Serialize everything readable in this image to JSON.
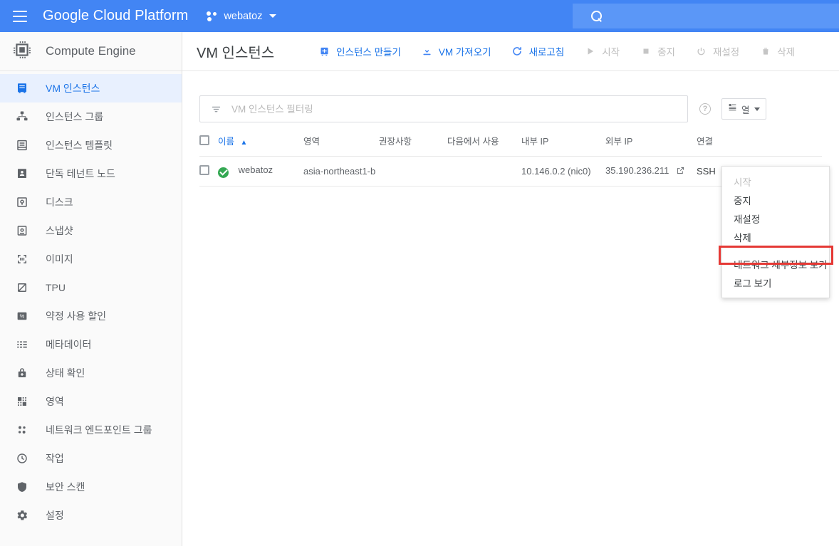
{
  "header": {
    "menu_icon": "hamburger-icon",
    "brand": "Google Cloud Platform",
    "project": "webatoz",
    "project_icon": "project-dots-icon",
    "search_icon": "search-icon",
    "search_value": "",
    "search_placeholder": "",
    "bg_color": "#4285f4"
  },
  "sidebar": {
    "product_icon": "cpu-chip-icon",
    "product": "Compute Engine",
    "items": [
      {
        "label": "VM 인스턴스",
        "icon": "vm-instance-icon",
        "active": true
      },
      {
        "label": "인스턴스 그룹",
        "icon": "instance-group-icon",
        "active": false
      },
      {
        "label": "인스턴스 템플릿",
        "icon": "instance-template-icon",
        "active": false
      },
      {
        "label": "단독 테넌트 노드",
        "icon": "sole-tenant-node-icon",
        "active": false
      },
      {
        "label": "디스크",
        "icon": "disk-icon",
        "active": false
      },
      {
        "label": "스냅샷",
        "icon": "snapshot-icon",
        "active": false
      },
      {
        "label": "이미지",
        "icon": "image-icon",
        "active": false
      },
      {
        "label": "TPU",
        "icon": "tpu-icon",
        "active": false
      },
      {
        "label": "약정 사용 할인",
        "icon": "percent-icon",
        "active": false
      },
      {
        "label": "메타데이터",
        "icon": "metadata-icon",
        "active": false
      },
      {
        "label": "상태 확인",
        "icon": "health-check-icon",
        "active": false
      },
      {
        "label": "영역",
        "icon": "zones-icon",
        "active": false
      },
      {
        "label": "네트워크 엔드포인트 그룹",
        "icon": "network-endpoint-group-icon",
        "active": false
      },
      {
        "label": "작업",
        "icon": "operations-clock-icon",
        "active": false
      },
      {
        "label": "보안 스캔",
        "icon": "security-scan-shield-icon",
        "active": false
      },
      {
        "label": "설정",
        "icon": "settings-gear-icon",
        "active": false
      }
    ]
  },
  "main": {
    "page_title": "VM 인스턴스",
    "toolbar": [
      {
        "label": "인스턴스 만들기",
        "icon": "create-instance-icon",
        "disabled": false
      },
      {
        "label": "VM 가져오기",
        "icon": "import-vm-download-icon",
        "disabled": false
      },
      {
        "label": "새로고침",
        "icon": "refresh-icon",
        "disabled": false
      },
      {
        "label": "시작",
        "icon": "play-start-icon",
        "disabled": true
      },
      {
        "label": "중지",
        "icon": "stop-square-icon",
        "disabled": true
      },
      {
        "label": "재설정",
        "icon": "reset-power-icon",
        "disabled": true
      },
      {
        "label": "삭제",
        "icon": "delete-trash-icon",
        "disabled": true
      }
    ],
    "filter": {
      "icon": "filter-icon",
      "placeholder": "VM 인스턴스 필터링",
      "value": "",
      "help_icon": "help-question-icon",
      "help_label": "?",
      "columns_label": "열",
      "columns_icon": "column-list-icon"
    },
    "table": {
      "columns": [
        "이름",
        "영역",
        "권장사항",
        "다음에서 사용",
        "내부 IP",
        "외부 IP",
        "연결"
      ],
      "sorted_column": "이름",
      "sort_direction_glyph": "▲",
      "rows": [
        {
          "status": "running",
          "status_icon": "green-check-status-icon",
          "name": "webatoz",
          "zone": "asia-northeast1-b",
          "recommendation": "",
          "used_by": "",
          "internal_ip": "10.146.0.2 (nic0)",
          "external_ip": "35.190.236.211",
          "external_ip_icon": "external-link-icon",
          "connect_label": "SSH",
          "connect_caret_icon": "chevron-down-icon",
          "row_menu_icon": "kebab-more-vert-icon"
        }
      ]
    },
    "context_menu": {
      "items": [
        {
          "label": "시작",
          "disabled": true,
          "highlighted": false
        },
        {
          "label": "중지",
          "disabled": false,
          "highlighted": false
        },
        {
          "label": "재설정",
          "disabled": false,
          "highlighted": false
        },
        {
          "label": "삭제",
          "disabled": false,
          "highlighted": false
        },
        {
          "label": "네트워크 세부정보 보기",
          "disabled": false,
          "highlighted": true
        },
        {
          "label": "로그 보기",
          "disabled": false,
          "highlighted": false
        }
      ],
      "highlight_color": "#e53935"
    }
  }
}
